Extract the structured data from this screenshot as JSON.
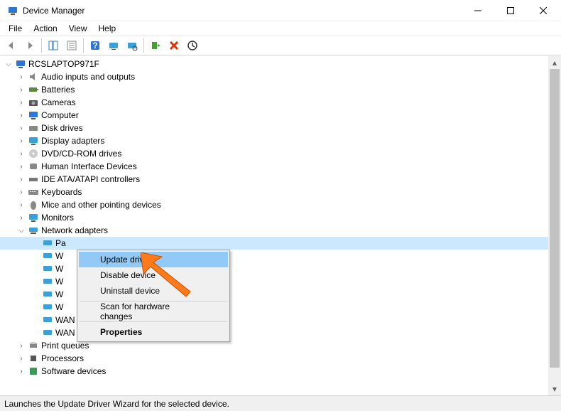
{
  "title": "Device Manager",
  "menubar": [
    "File",
    "Action",
    "View",
    "Help"
  ],
  "toolbar_icons": [
    "back",
    "forward",
    "|",
    "show-hide-console",
    "properties",
    "|",
    "help",
    "update-driver-tool",
    "scan-hardware",
    "|",
    "add-legacy",
    "uninstall",
    "disable"
  ],
  "root": {
    "label": "RCSLAPTOP971F",
    "icon": "computer"
  },
  "categories": [
    {
      "label": "Audio inputs and outputs",
      "icon": "audio",
      "expanded": false
    },
    {
      "label": "Batteries",
      "icon": "battery",
      "expanded": false
    },
    {
      "label": "Cameras",
      "icon": "camera",
      "expanded": false
    },
    {
      "label": "Computer",
      "icon": "computer",
      "expanded": false
    },
    {
      "label": "Disk drives",
      "icon": "disk",
      "expanded": false
    },
    {
      "label": "Display adapters",
      "icon": "display",
      "expanded": false
    },
    {
      "label": "DVD/CD-ROM drives",
      "icon": "dvd",
      "expanded": false
    },
    {
      "label": "Human Interface Devices",
      "icon": "hid",
      "expanded": false
    },
    {
      "label": "IDE ATA/ATAPI controllers",
      "icon": "ide",
      "expanded": false
    },
    {
      "label": "Keyboards",
      "icon": "keyboard",
      "expanded": false
    },
    {
      "label": "Mice and other pointing devices",
      "icon": "mouse",
      "expanded": false
    },
    {
      "label": "Monitors",
      "icon": "monitor",
      "expanded": false
    },
    {
      "label": "Network adapters",
      "icon": "network",
      "expanded": true
    },
    {
      "label": "Print queues",
      "icon": "printer",
      "expanded": false
    },
    {
      "label": "Processors",
      "icon": "cpu",
      "expanded": false
    },
    {
      "label": "Software devices",
      "icon": "software",
      "expanded": false
    }
  ],
  "network_children": [
    {
      "label_visible": "Pa",
      "icon": "netcard",
      "selected": true
    },
    {
      "label_visible": "W",
      "icon": "netcard"
    },
    {
      "label_visible": "W",
      "icon": "netcard"
    },
    {
      "label_visible": "W",
      "icon": "netcard"
    },
    {
      "label_visible": "W",
      "icon": "netcard"
    },
    {
      "label_visible": "W",
      "icon": "netcard"
    },
    {
      "label_visible": "WAN Miniport (PPTP)",
      "label_partial": "WAN Miniport (",
      "icon": "netcard"
    },
    {
      "label_visible": "WAN Miniport (SSTP)",
      "icon": "netcard"
    }
  ],
  "context_menu": {
    "items": [
      {
        "label": "Update driver",
        "highlight": true
      },
      {
        "label": "Disable device"
      },
      {
        "label": "Uninstall device"
      },
      {
        "sep": true
      },
      {
        "label": "Scan for hardware changes"
      },
      {
        "sep": true
      },
      {
        "label": "Properties",
        "bold": true
      }
    ]
  },
  "statusbar": "Launches the Update Driver Wizard for the selected device.",
  "pointer_color": "#ff7a1a"
}
